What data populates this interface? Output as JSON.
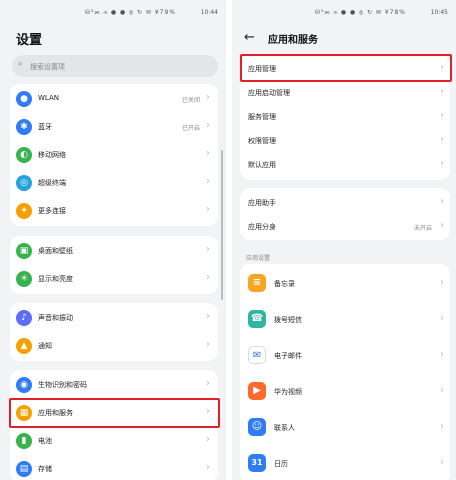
{
  "left": {
    "status": {
      "icons": "⛁³⫘ ⫙ ● ●  ⦾ ↻ ✉ ¥79%",
      "time": "10:44"
    },
    "title": "设置",
    "search_placeholder": "搜索设置项",
    "group1": [
      {
        "label": "WLAN",
        "value": "已关闭",
        "icon": "wifi-icon",
        "color": "#2f7cf6",
        "glyph": "●"
      },
      {
        "label": "蓝牙",
        "value": "已开启",
        "icon": "bluetooth-icon",
        "color": "#2f7cf6",
        "glyph": "✱"
      },
      {
        "label": "移动网络",
        "value": "",
        "icon": "mobile-network-icon",
        "color": "#37b24d",
        "glyph": "◐"
      },
      {
        "label": "超级终端",
        "value": "",
        "icon": "super-device-icon",
        "color": "#22a3e0",
        "glyph": "◎"
      },
      {
        "label": "更多连接",
        "value": "",
        "icon": "more-connections-icon",
        "color": "#f59f00",
        "glyph": "✦"
      }
    ],
    "group2": [
      {
        "label": "桌面和壁纸",
        "icon": "desktop-wallpaper-icon",
        "color": "#37b24d",
        "glyph": "▣"
      },
      {
        "label": "显示和亮度",
        "icon": "display-brightness-icon",
        "color": "#37b24d",
        "glyph": "☀"
      }
    ],
    "group3": [
      {
        "label": "声音和振动",
        "icon": "sound-icon",
        "color": "#5b6ef5",
        "glyph": "♪"
      },
      {
        "label": "通知",
        "icon": "notification-icon",
        "color": "#f59f00",
        "glyph": "▲"
      }
    ],
    "group4": [
      {
        "label": "生物识别和密码",
        "icon": "biometric-icon",
        "color": "#2f7cf6",
        "glyph": "◉"
      },
      {
        "label": "应用和服务",
        "icon": "apps-services-icon",
        "color": "#f59f00",
        "glyph": "▦"
      },
      {
        "label": "电池",
        "icon": "battery-icon",
        "color": "#37b24d",
        "glyph": "▮"
      },
      {
        "label": "存储",
        "icon": "storage-icon",
        "color": "#2f7cf6",
        "glyph": "▤"
      }
    ]
  },
  "right": {
    "status": {
      "icons": "⛁³⫘ ⫙ ● ●  ⦾ ↻ ✉ ¥78%",
      "time": "10:45"
    },
    "back_glyph": "←",
    "title": "应用和服务",
    "group1": [
      {
        "label": "应用管理"
      },
      {
        "label": "应用启动管理"
      },
      {
        "label": "服务管理"
      },
      {
        "label": "权限管理"
      },
      {
        "label": "默认应用"
      }
    ],
    "group2": [
      {
        "label": "应用助手",
        "value": ""
      },
      {
        "label": "应用分身",
        "value": "未开启"
      }
    ],
    "section_label": "应用设置",
    "apps": [
      {
        "label": "备忘录",
        "icon": "memo-app-icon",
        "color": "#f5a623",
        "glyph": "≡"
      },
      {
        "label": "拨号短信",
        "icon": "phone-sms-app-icon",
        "color": "#2fb5a0",
        "glyph": "☎"
      },
      {
        "label": "电子邮件",
        "icon": "email-app-icon",
        "color": "#ffffff",
        "glyph": "✉"
      },
      {
        "label": "华为视频",
        "icon": "huawei-video-app-icon",
        "color": "#ff6a2b",
        "glyph": "▶"
      },
      {
        "label": "联系人",
        "icon": "contacts-app-icon",
        "color": "#2f7cf6",
        "glyph": "☺"
      },
      {
        "label": "日历",
        "icon": "calendar-app-icon",
        "color": "#2f7cf6",
        "glyph": "31"
      }
    ]
  },
  "chevron": "›",
  "search_glyph": "⌕"
}
